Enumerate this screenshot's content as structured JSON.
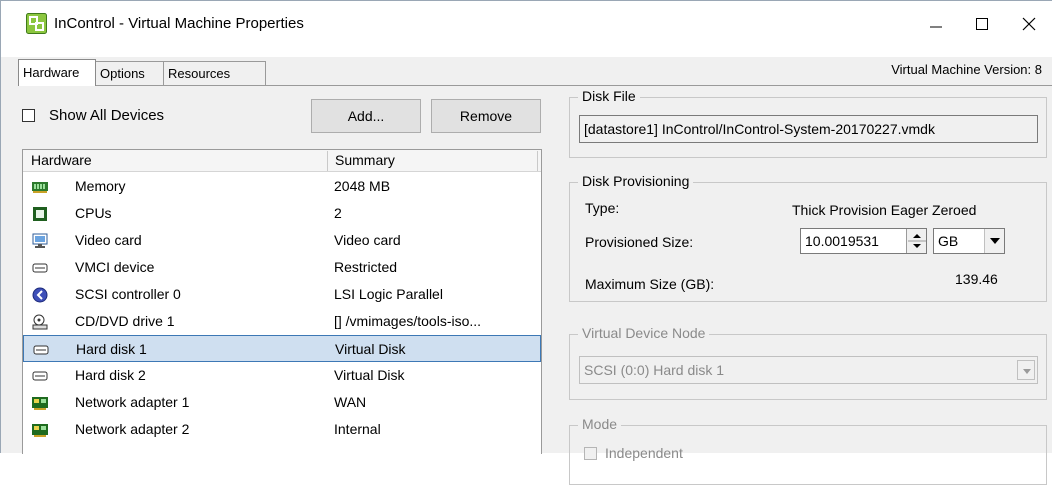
{
  "window": {
    "title": "InControl - Virtual Machine Properties"
  },
  "tabs": [
    {
      "label": "Hardware",
      "active": true
    },
    {
      "label": "Options",
      "active": false
    },
    {
      "label": "Resources",
      "active": false
    }
  ],
  "vm_version": "Virtual Machine Version: 8",
  "controls": {
    "show_all_devices_label": "Show All Devices",
    "show_all_devices_checked": false,
    "add_label": "Add...",
    "remove_label": "Remove"
  },
  "hardware_list": {
    "columns": [
      "Hardware",
      "Summary"
    ],
    "rows": [
      {
        "name": "Memory",
        "summary": "2048 MB",
        "icon": "memory-icon"
      },
      {
        "name": "CPUs",
        "summary": "2",
        "icon": "cpu-icon"
      },
      {
        "name": "Video card",
        "summary": "Video card",
        "icon": "monitor-icon"
      },
      {
        "name": "VMCI device",
        "summary": "Restricted",
        "icon": "device-icon"
      },
      {
        "name": "SCSI controller 0",
        "summary": "LSI Logic Parallel",
        "icon": "scsi-controller-icon"
      },
      {
        "name": "CD/DVD drive 1",
        "summary": "[] /vmimages/tools-iso...",
        "icon": "cd-drive-icon"
      },
      {
        "name": "Hard disk 1",
        "summary": "Virtual Disk",
        "icon": "hard-disk-icon",
        "selected": true
      },
      {
        "name": "Hard disk 2",
        "summary": "Virtual Disk",
        "icon": "hard-disk-icon"
      },
      {
        "name": "Network adapter 1",
        "summary": "WAN",
        "icon": "network-adapter-icon"
      },
      {
        "name": "Network adapter 2",
        "summary": "Internal",
        "icon": "network-adapter-icon"
      }
    ]
  },
  "disk_file": {
    "group_label": "Disk File",
    "value": "[datastore1] InControl/InControl-System-20170227.vmdk"
  },
  "disk_provisioning": {
    "group_label": "Disk Provisioning",
    "type_label": "Type:",
    "type_value": "Thick Provision Eager Zeroed",
    "provisioned_label": "Provisioned Size:",
    "provisioned_value": "10.0019531",
    "unit_value": "GB",
    "max_label": "Maximum Size (GB):",
    "max_value": "139.46"
  },
  "virtual_device_node": {
    "group_label": "Virtual Device Node",
    "value": "SCSI (0:0) Hard disk 1"
  },
  "mode": {
    "group_label": "Mode",
    "independent_label": "Independent"
  },
  "colors": {
    "selection_bg": "#cfdff0",
    "selection_border": "#3d78b5",
    "window_bg": "#f0f0f0"
  }
}
